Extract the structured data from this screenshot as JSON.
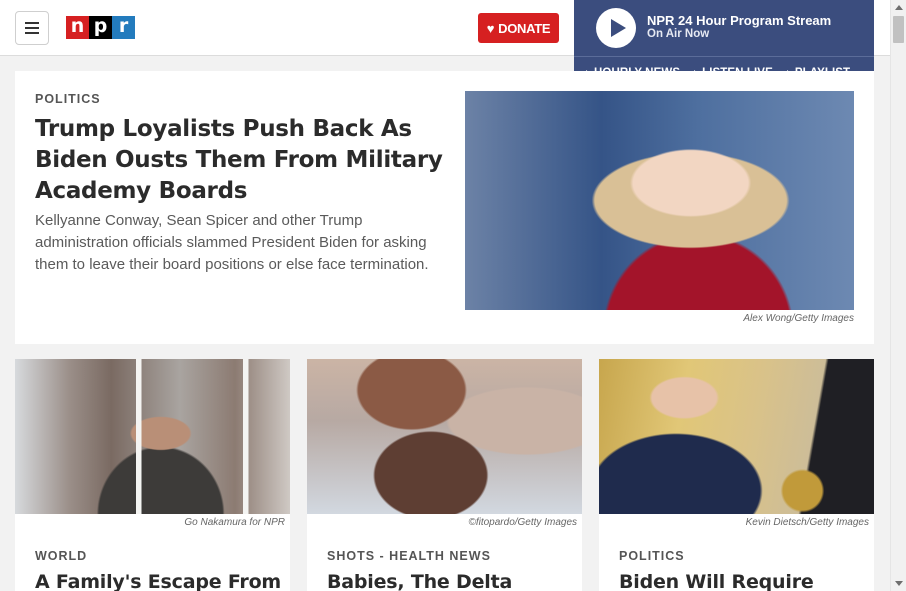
{
  "header": {
    "logo_letters": [
      "n",
      "p",
      "r"
    ],
    "logo_colors": [
      "#d62021",
      "#000000",
      "#237bbd"
    ],
    "donate_label": "DONATE",
    "donate_icon": "heart-icon"
  },
  "stream": {
    "title": "NPR 24 Hour Program Stream",
    "subtitle": "On Air Now",
    "links": [
      "HOURLY NEWS",
      "LISTEN LIVE",
      "PLAYLIST"
    ]
  },
  "feature": {
    "slug": "POLITICS",
    "headline": "Trump Loyalists Push Back As Biden Ousts Them From Military Academy Boards",
    "teaser": "Kellyanne Conway, Sean Spicer and other Trump administration officials slammed President Biden for asking them to leave their board positions or else face termination.",
    "image_credit": "Alex Wong/Getty Images"
  },
  "cards": [
    {
      "image_credit": "Go Nakamura for NPR",
      "slug": "WORLD",
      "headline": "A Family's Escape From"
    },
    {
      "image_credit": "©fitopardo/Getty Images",
      "slug": "SHOTS - HEALTH NEWS",
      "headline": "Babies, The Delta"
    },
    {
      "image_credit": "Kevin Dietsch/Getty Images",
      "slug": "POLITICS",
      "headline": "Biden Will Require"
    }
  ],
  "colors": {
    "donate": "#d62021",
    "stream_panel": "#3b4d7e"
  }
}
